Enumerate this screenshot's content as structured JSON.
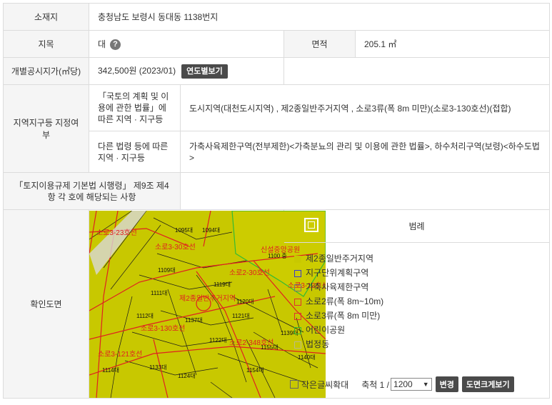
{
  "location": {
    "label": "소재지",
    "value": "충청남도 보령시 동대동 1138번지"
  },
  "jimok": {
    "label": "지목",
    "value": "대",
    "help_icon": "question-icon"
  },
  "area": {
    "label": "면적",
    "value": "205.1 ㎡"
  },
  "price": {
    "label": "개별공시지가(㎡당)",
    "value": "342,500원 (2023/01)",
    "button": "연도별보기"
  },
  "zoning": {
    "label": "지역지구등 지정여부",
    "row1_label": "「국토의 계획 및 이용에 관한 법률」에 따른 지역 · 지구등",
    "row1_value": "도시지역(대천도시지역) , 제2종일반주거지역 , 소로3류(폭 8m 미만)(소로3-130호선)(접합)",
    "row2_label": "다른 법령 등에 따른 지역 · 지구등",
    "row2_value": "가축사육제한구역(전부제한)<가축분뇨의 관리 및 이용에 관한 법률>, 하수처리구역(보령)<하수도법>"
  },
  "article": {
    "label": "「토지이용규제 기본법 시행령」 제9조 제4항 각 호에 해당되는 사항",
    "value": ""
  },
  "map": {
    "label": "확인도면",
    "labels": [
      "1095대",
      "1094대",
      "1109대",
      "1111대",
      "1119대",
      "1120대",
      "1112대",
      "1137대",
      "1122대",
      "1121대",
      "1139대",
      "1140대",
      "1133대",
      "1154대",
      "1124대",
      "1114대",
      "1155대",
      "1100 중",
      "신설중앙공원",
      "소로3-23호선",
      "소로3-30호선",
      "소로2-30호선",
      "제2종일반주거지역",
      "소로3-130호선",
      "소로3-121호선",
      "소로2-348호선",
      "소로3-13호선"
    ]
  },
  "legend": {
    "title": "범례",
    "items": [
      {
        "label": "제2종일반주거지역",
        "color": "#c8c800",
        "fill": true
      },
      {
        "label": "지구단위계획구역",
        "color": "#3a3acf",
        "fill": false
      },
      {
        "label": "가축사육제한구역",
        "color": "#777777",
        "fill": false
      },
      {
        "label": "소로2류(폭 8m~10m)",
        "color": "#e03030",
        "fill": false
      },
      {
        "label": "소로3류(폭 8m 미만)",
        "color": "#e03030",
        "fill": false
      },
      {
        "label": "어린이공원",
        "color": "#33bb33",
        "fill": false
      },
      {
        "label": "법정동",
        "color": "#bbbb88",
        "fill": false
      }
    ]
  },
  "controls": {
    "enlarge_text": "작은글씨확대",
    "scale_label": "축척 1 /",
    "scale_value": "1200",
    "change_button": "변경",
    "full_button": "도면크게보기"
  }
}
